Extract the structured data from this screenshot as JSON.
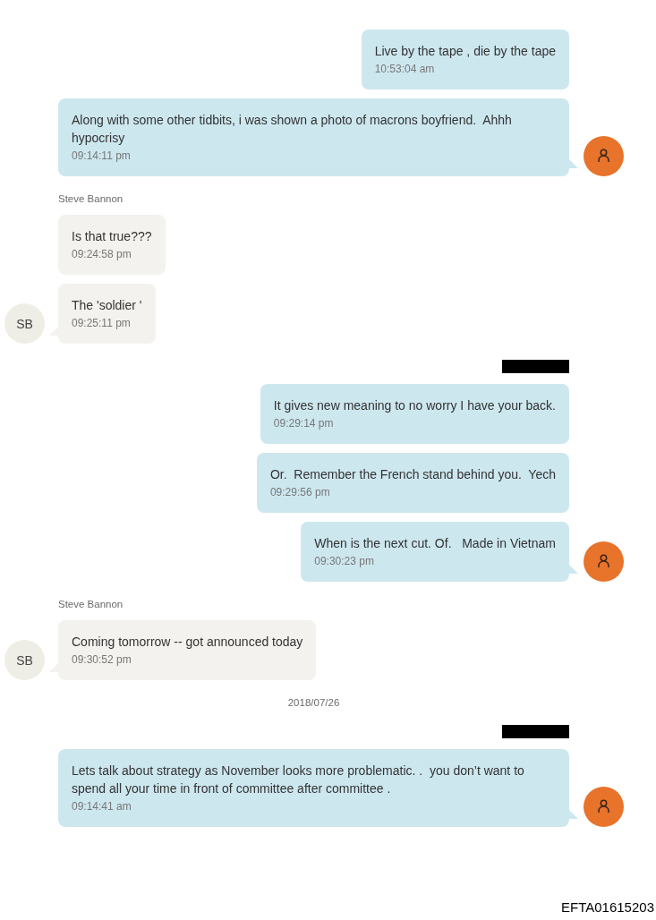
{
  "conversation": [
    {
      "kind": "outgoing",
      "messages": [
        {
          "text": "Live by the tape , die by the tape",
          "time": "10:53:04 am"
        },
        {
          "text": "Along with some other tidbits, i was shown a photo of macrons boyfriend.  Ahhh hypocrisy",
          "time": "09:14:11 pm"
        }
      ]
    },
    {
      "kind": "incoming",
      "sender": "Steve Bannon",
      "avatar_initials": "SB",
      "messages": [
        {
          "text": "Is that true???",
          "time": "09:24:58 pm"
        },
        {
          "text": "The 'soldier '",
          "time": "09:25:11 pm"
        }
      ]
    },
    {
      "kind": "outgoing",
      "sender_redacted": true,
      "messages": [
        {
          "text": "It gives new meaning to no worry I have your back.",
          "time": "09:29:14 pm"
        },
        {
          "text": "Or.  Remember the French stand behind you.  Yech",
          "time": "09:29:56 pm"
        },
        {
          "text": "When is the next cut. Of.   Made in Vietnam",
          "time": "09:30:23 pm"
        }
      ]
    },
    {
      "kind": "incoming",
      "sender": "Steve Bannon",
      "avatar_initials": "SB",
      "messages": [
        {
          "text": "Coming tomorrow -- got announced today",
          "time": "09:30:52 pm"
        }
      ]
    },
    {
      "kind": "date",
      "label": "2018/07/26"
    },
    {
      "kind": "outgoing",
      "sender_redacted": true,
      "messages": [
        {
          "text": "Lets talk about strategy as November looks more problematic. .  you don’t want to spend all your time in front of committee after committee .",
          "time": "09:14:41 am"
        }
      ]
    }
  ],
  "document_id": "EFTA01615203"
}
